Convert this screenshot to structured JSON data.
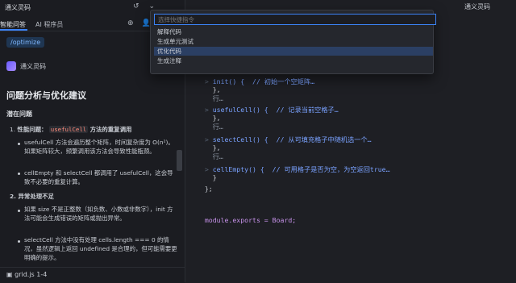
{
  "window": {
    "title": "通义灵码"
  },
  "left_panel": {
    "title": "通义灵码",
    "tabs": [
      "智能问答",
      "AI 程序员"
    ],
    "command_pill": "/optimize",
    "assistant_name": "通义灵码",
    "heading": "问题分析与优化建议",
    "subheading": "潜在问题",
    "points": [
      {
        "num": "1.",
        "title_prefix": "性能问题：",
        "code": "usefulCell",
        "title_suffix": " 方法的重复调用",
        "bullets": [
          {
            "text": "usefulCell 方法会遍历整个矩阵，时间复杂度为 O(n²)。如果矩阵较大，频繁调用该方法会导致性能瓶颈。"
          },
          {
            "text": "cellEmpty 和 selectCell 都调用了 usefulCell，这会导致不必要的重复计算。"
          }
        ]
      },
      {
        "num": "2.",
        "title": "异常处理不足",
        "bullets": [
          {
            "text": "如果 size 不是正整数（如负数、小数或非数字），init 方法可能会生成错误的矩阵或抛出异常。"
          },
          {
            "text": "selectCell 方法中没有处理 cells.length === 0 的情况，虽然逻辑上返回 undefined 是合理的，但可能需要更明确的提示。"
          }
        ]
      }
    ],
    "status_file": "grid.js 1-4"
  },
  "quick_pick": {
    "placeholder": "选择快捷指令",
    "items": [
      "解释代码",
      "生成单元测试",
      "优化代码",
      "生成注释"
    ],
    "selected_index": 2
  },
  "code": [
    {
      "ln": "",
      "text": "init() {  // 初始一个空矩阵…"
    },
    {
      "ln": "",
      "text": "},"
    },
    {
      "ln": "",
      "text": "行…"
    },
    {
      "ln": "",
      "text": "usefulCell() {  // 记录当前空格子…"
    },
    {
      "ln": "",
      "text": "},"
    },
    {
      "ln": "",
      "text": "行…"
    },
    {
      "ln": "",
      "text": "selectCell() {  // 从可填充格子中随机选一个…"
    },
    {
      "ln": "",
      "text": "},"
    },
    {
      "ln": "",
      "text": "行…"
    },
    {
      "ln": "",
      "text": "cellEmpty() {  // 可用格子是否为空，为空返回true…"
    },
    {
      "ln": "",
      "text": "}"
    },
    {
      "ln": "",
      "text": "};"
    },
    {
      "ln": "",
      "text": ""
    },
    {
      "ln": "",
      "text": "module.exports = Board;"
    }
  ]
}
